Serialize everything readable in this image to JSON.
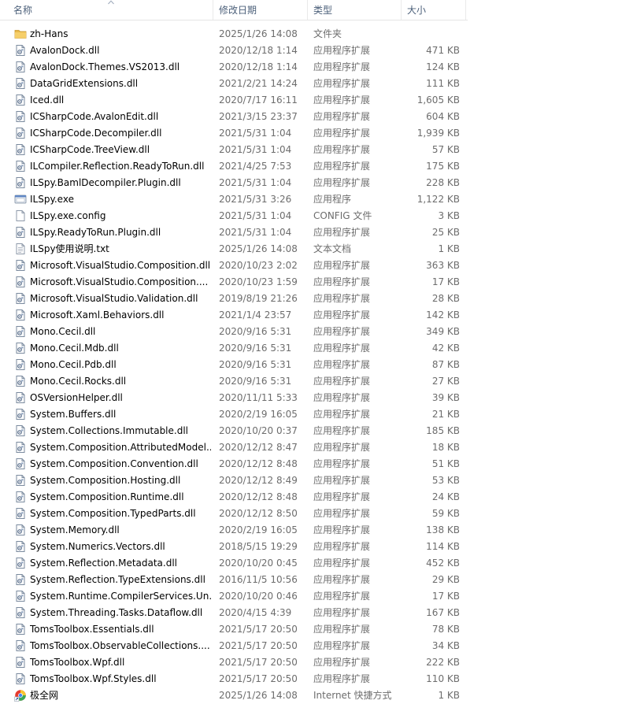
{
  "columns": {
    "name": "名称",
    "date": "修改日期",
    "type": "类型",
    "size": "大小"
  },
  "icon_types": {
    "folder": "folder-icon",
    "dll": "dll-file-icon",
    "exe": "exe-file-icon",
    "config": "config-file-icon",
    "txt": "text-file-icon",
    "link": "browser-shortcut-icon"
  },
  "colors": {
    "folder": "#e8b84a",
    "header_text": "#4c607a",
    "detail_text": "#6d6d6d"
  },
  "files": [
    {
      "name": "zh-Hans",
      "date": "2025/1/26 14:08",
      "type": "文件夹",
      "size": "",
      "icon": "folder"
    },
    {
      "name": "AvalonDock.dll",
      "date": "2020/12/18 1:14",
      "type": "应用程序扩展",
      "size": "471 KB",
      "icon": "dll"
    },
    {
      "name": "AvalonDock.Themes.VS2013.dll",
      "date": "2020/12/18 1:14",
      "type": "应用程序扩展",
      "size": "124 KB",
      "icon": "dll"
    },
    {
      "name": "DataGridExtensions.dll",
      "date": "2021/2/21 14:24",
      "type": "应用程序扩展",
      "size": "111 KB",
      "icon": "dll"
    },
    {
      "name": "Iced.dll",
      "date": "2020/7/17 16:11",
      "type": "应用程序扩展",
      "size": "1,605 KB",
      "icon": "dll"
    },
    {
      "name": "ICSharpCode.AvalonEdit.dll",
      "date": "2021/3/15 23:37",
      "type": "应用程序扩展",
      "size": "604 KB",
      "icon": "dll"
    },
    {
      "name": "ICSharpCode.Decompiler.dll",
      "date": "2021/5/31 1:04",
      "type": "应用程序扩展",
      "size": "1,939 KB",
      "icon": "dll"
    },
    {
      "name": "ICSharpCode.TreeView.dll",
      "date": "2021/5/31 1:04",
      "type": "应用程序扩展",
      "size": "57 KB",
      "icon": "dll"
    },
    {
      "name": "ILCompiler.Reflection.ReadyToRun.dll",
      "date": "2021/4/25 7:53",
      "type": "应用程序扩展",
      "size": "175 KB",
      "icon": "dll"
    },
    {
      "name": "ILSpy.BamlDecompiler.Plugin.dll",
      "date": "2021/5/31 1:04",
      "type": "应用程序扩展",
      "size": "228 KB",
      "icon": "dll"
    },
    {
      "name": "ILSpy.exe",
      "date": "2021/5/31 3:26",
      "type": "应用程序",
      "size": "1,122 KB",
      "icon": "exe"
    },
    {
      "name": "ILSpy.exe.config",
      "date": "2021/5/31 1:04",
      "type": "CONFIG 文件",
      "size": "3 KB",
      "icon": "config"
    },
    {
      "name": "ILSpy.ReadyToRun.Plugin.dll",
      "date": "2021/5/31 1:04",
      "type": "应用程序扩展",
      "size": "25 KB",
      "icon": "dll"
    },
    {
      "name": "ILSpy使用说明.txt",
      "date": "2025/1/26 14:08",
      "type": "文本文档",
      "size": "1 KB",
      "icon": "txt"
    },
    {
      "name": "Microsoft.VisualStudio.Composition.dll",
      "date": "2020/10/23 2:02",
      "type": "应用程序扩展",
      "size": "363 KB",
      "icon": "dll"
    },
    {
      "name": "Microsoft.VisualStudio.Composition....",
      "date": "2020/10/23 1:59",
      "type": "应用程序扩展",
      "size": "17 KB",
      "icon": "dll"
    },
    {
      "name": "Microsoft.VisualStudio.Validation.dll",
      "date": "2019/8/19 21:26",
      "type": "应用程序扩展",
      "size": "28 KB",
      "icon": "dll"
    },
    {
      "name": "Microsoft.Xaml.Behaviors.dll",
      "date": "2021/1/4 23:57",
      "type": "应用程序扩展",
      "size": "142 KB",
      "icon": "dll"
    },
    {
      "name": "Mono.Cecil.dll",
      "date": "2020/9/16 5:31",
      "type": "应用程序扩展",
      "size": "349 KB",
      "icon": "dll"
    },
    {
      "name": "Mono.Cecil.Mdb.dll",
      "date": "2020/9/16 5:31",
      "type": "应用程序扩展",
      "size": "42 KB",
      "icon": "dll"
    },
    {
      "name": "Mono.Cecil.Pdb.dll",
      "date": "2020/9/16 5:31",
      "type": "应用程序扩展",
      "size": "87 KB",
      "icon": "dll"
    },
    {
      "name": "Mono.Cecil.Rocks.dll",
      "date": "2020/9/16 5:31",
      "type": "应用程序扩展",
      "size": "27 KB",
      "icon": "dll"
    },
    {
      "name": "OSVersionHelper.dll",
      "date": "2020/11/11 5:33",
      "type": "应用程序扩展",
      "size": "39 KB",
      "icon": "dll"
    },
    {
      "name": "System.Buffers.dll",
      "date": "2020/2/19 16:05",
      "type": "应用程序扩展",
      "size": "21 KB",
      "icon": "dll"
    },
    {
      "name": "System.Collections.Immutable.dll",
      "date": "2020/10/20 0:37",
      "type": "应用程序扩展",
      "size": "185 KB",
      "icon": "dll"
    },
    {
      "name": "System.Composition.AttributedModel...",
      "date": "2020/12/12 8:47",
      "type": "应用程序扩展",
      "size": "18 KB",
      "icon": "dll"
    },
    {
      "name": "System.Composition.Convention.dll",
      "date": "2020/12/12 8:48",
      "type": "应用程序扩展",
      "size": "51 KB",
      "icon": "dll"
    },
    {
      "name": "System.Composition.Hosting.dll",
      "date": "2020/12/12 8:49",
      "type": "应用程序扩展",
      "size": "53 KB",
      "icon": "dll"
    },
    {
      "name": "System.Composition.Runtime.dll",
      "date": "2020/12/12 8:48",
      "type": "应用程序扩展",
      "size": "24 KB",
      "icon": "dll"
    },
    {
      "name": "System.Composition.TypedParts.dll",
      "date": "2020/12/12 8:50",
      "type": "应用程序扩展",
      "size": "59 KB",
      "icon": "dll"
    },
    {
      "name": "System.Memory.dll",
      "date": "2020/2/19 16:05",
      "type": "应用程序扩展",
      "size": "138 KB",
      "icon": "dll"
    },
    {
      "name": "System.Numerics.Vectors.dll",
      "date": "2018/5/15 19:29",
      "type": "应用程序扩展",
      "size": "114 KB",
      "icon": "dll"
    },
    {
      "name": "System.Reflection.Metadata.dll",
      "date": "2020/10/20 0:45",
      "type": "应用程序扩展",
      "size": "452 KB",
      "icon": "dll"
    },
    {
      "name": "System.Reflection.TypeExtensions.dll",
      "date": "2016/11/5 10:56",
      "type": "应用程序扩展",
      "size": "29 KB",
      "icon": "dll"
    },
    {
      "name": "System.Runtime.CompilerServices.Un...",
      "date": "2020/10/20 0:46",
      "type": "应用程序扩展",
      "size": "17 KB",
      "icon": "dll"
    },
    {
      "name": "System.Threading.Tasks.Dataflow.dll",
      "date": "2020/4/15 4:39",
      "type": "应用程序扩展",
      "size": "167 KB",
      "icon": "dll"
    },
    {
      "name": "TomsToolbox.Essentials.dll",
      "date": "2021/5/17 20:50",
      "type": "应用程序扩展",
      "size": "78 KB",
      "icon": "dll"
    },
    {
      "name": "TomsToolbox.ObservableCollections....",
      "date": "2021/5/17 20:50",
      "type": "应用程序扩展",
      "size": "34 KB",
      "icon": "dll"
    },
    {
      "name": "TomsToolbox.Wpf.dll",
      "date": "2021/5/17 20:50",
      "type": "应用程序扩展",
      "size": "222 KB",
      "icon": "dll"
    },
    {
      "name": "TomsToolbox.Wpf.Styles.dll",
      "date": "2021/5/17 20:50",
      "type": "应用程序扩展",
      "size": "110 KB",
      "icon": "dll"
    },
    {
      "name": "极全网",
      "date": "2025/1/26 14:08",
      "type": "Internet 快捷方式",
      "size": "1 KB",
      "icon": "link"
    }
  ]
}
